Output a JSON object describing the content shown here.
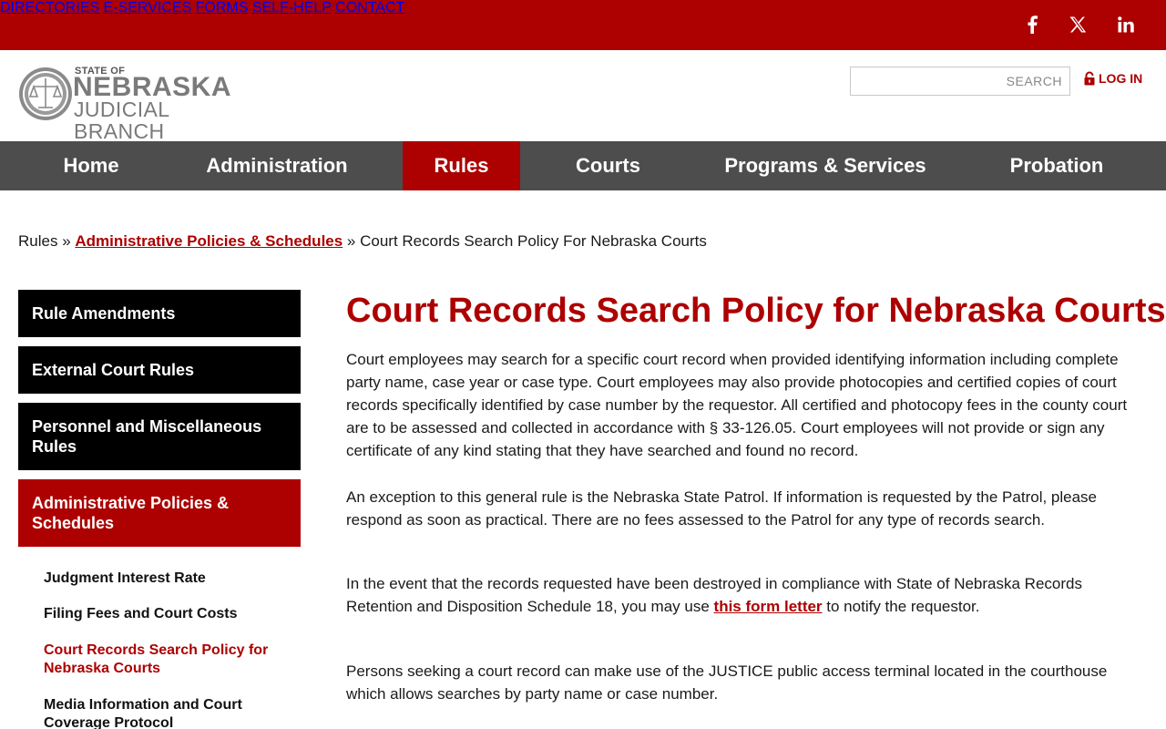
{
  "colors": {
    "brand_red": "#ad0000",
    "nav_gray": "#4d4d4d",
    "sidebar_black": "#000000"
  },
  "top_links": [
    "DIRECTORIES",
    "E-SERVICES",
    "FORMS",
    "SELF-HELP",
    "CONTACT"
  ],
  "social": {
    "facebook": "f",
    "x": "𝕏",
    "linkedin": "in"
  },
  "logo": {
    "line1": "STATE OF",
    "line2": "NEBRASKA",
    "line3": "JUDICIAL BRANCH"
  },
  "search": {
    "placeholder": "SEARCH"
  },
  "login": {
    "label": "LOG IN",
    "icon": "lock-icon"
  },
  "main_nav": [
    "Home",
    "Administration",
    "Rules",
    "Courts",
    "Programs & Services",
    "Probation"
  ],
  "breadcrumb": {
    "root": "Rules",
    "sep": " » ",
    "parent": "Administrative Policies & Schedules",
    "current": "Court Records Search Policy For Nebraska Courts"
  },
  "sidebar": {
    "sections": [
      "Rule Amendments",
      "External Court Rules",
      "Personnel and Miscellaneous Rules",
      "Administrative Policies & Schedules"
    ],
    "subitems": [
      "Judgment Interest Rate",
      "Filing Fees and Court Costs",
      "Court Records Search Policy for Nebraska Courts",
      "Media Information and Court Coverage Protocol"
    ]
  },
  "content": {
    "title": "Court Records Search Policy for Nebraska Courts",
    "p1": "Court employees may search for a specific court record when provided identifying information including complete party name, case year or case type.  Court employees may also provide photocopies and certified copies of court records specifically identified by case number by the requestor. All certified and photocopy fees in the county court are to be assessed and collected in accordance with § 33-126.05. Court employees will not provide or sign any certificate of any kind stating that they have searched and found no record.",
    "p2": "An exception to this general rule is the Nebraska State Patrol. If information is requested by the Patrol, please respond as soon as practical. There are no fees assessed to the Patrol for any type of records search.",
    "p3_before": "In the event that the records requested have been destroyed in compliance with State of Nebraska Records Retention and Disposition Schedule 18, you may use ",
    "p3_link": "this form letter",
    "p3_after": " to notify the requestor.",
    "p4": "Persons seeking a court record can make use of the JUSTICE public access terminal located in the courthouse which allows searches by party name or case number."
  }
}
